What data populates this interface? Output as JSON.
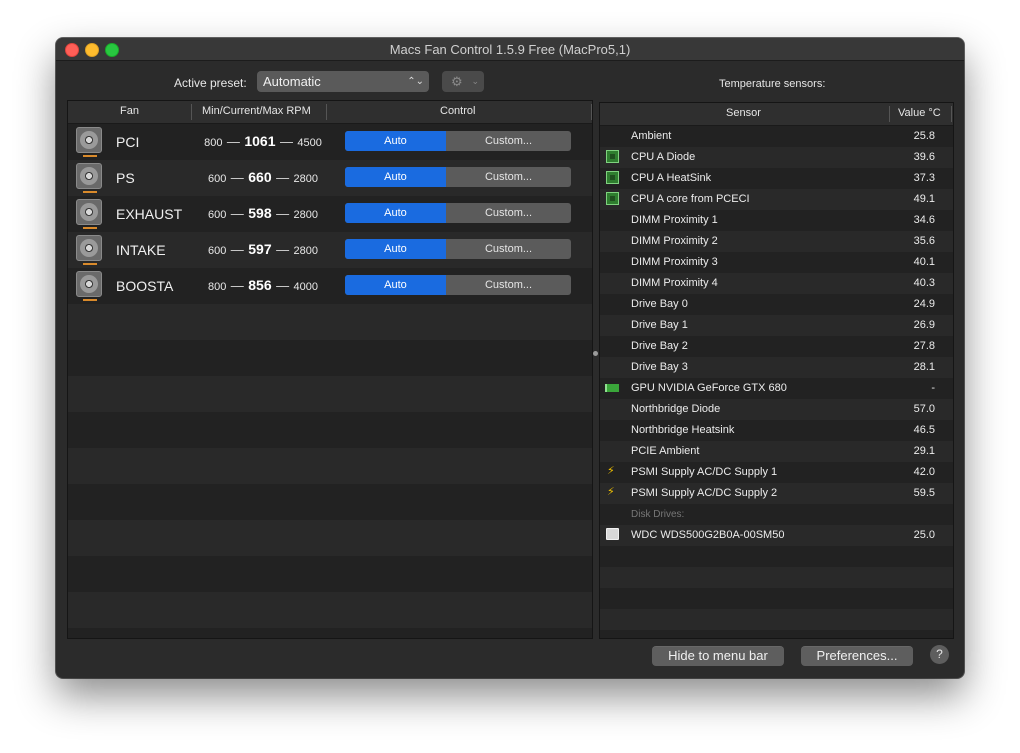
{
  "window": {
    "title": "Macs Fan Control 1.5.9 Free (MacPro5,1)"
  },
  "preset": {
    "label": "Active preset:",
    "value": "Automatic",
    "gear_icon": "gear-icon"
  },
  "sensors_title": "Temperature sensors:",
  "fan_table": {
    "columns": [
      "Fan",
      "Min/Current/Max RPM",
      "Control"
    ],
    "rows": [
      {
        "name": "PCI",
        "min": "800",
        "current": "1061",
        "max": "4500",
        "auto": "Auto",
        "custom": "Custom..."
      },
      {
        "name": "PS",
        "min": "600",
        "current": "660",
        "max": "2800",
        "auto": "Auto",
        "custom": "Custom..."
      },
      {
        "name": "EXHAUST",
        "min": "600",
        "current": "598",
        "max": "2800",
        "auto": "Auto",
        "custom": "Custom..."
      },
      {
        "name": "INTAKE",
        "min": "600",
        "current": "597",
        "max": "2800",
        "auto": "Auto",
        "custom": "Custom..."
      },
      {
        "name": "BOOSTA",
        "min": "800",
        "current": "856",
        "max": "4000",
        "auto": "Auto",
        "custom": "Custom..."
      }
    ],
    "dash": "—"
  },
  "sensor_table": {
    "columns": [
      "Sensor",
      "Value °C"
    ],
    "rows": [
      {
        "name": "Ambient",
        "value": "25.8",
        "icon": ""
      },
      {
        "name": "CPU A Diode",
        "value": "39.6",
        "icon": "chip"
      },
      {
        "name": "CPU A HeatSink",
        "value": "37.3",
        "icon": "chip"
      },
      {
        "name": "CPU A core from PCECI",
        "value": "49.1",
        "icon": "chip"
      },
      {
        "name": "DIMM Proximity 1",
        "value": "34.6",
        "icon": ""
      },
      {
        "name": "DIMM Proximity 2",
        "value": "35.6",
        "icon": ""
      },
      {
        "name": "DIMM Proximity 3",
        "value": "40.1",
        "icon": ""
      },
      {
        "name": "DIMM Proximity 4",
        "value": "40.3",
        "icon": ""
      },
      {
        "name": "Drive Bay 0",
        "value": "24.9",
        "icon": ""
      },
      {
        "name": "Drive Bay 1",
        "value": "26.9",
        "icon": ""
      },
      {
        "name": "Drive Bay 2",
        "value": "27.8",
        "icon": ""
      },
      {
        "name": "Drive Bay 3",
        "value": "28.1",
        "icon": ""
      },
      {
        "name": "GPU NVIDIA GeForce GTX 680",
        "value": "-",
        "icon": "gpu"
      },
      {
        "name": "Northbridge Diode",
        "value": "57.0",
        "icon": ""
      },
      {
        "name": "Northbridge Heatsink",
        "value": "46.5",
        "icon": ""
      },
      {
        "name": "PCIE Ambient",
        "value": "29.1",
        "icon": ""
      },
      {
        "name": "PSMI Supply AC/DC Supply 1",
        "value": "42.0",
        "icon": "bolt"
      },
      {
        "name": "PSMI Supply AC/DC Supply 2",
        "value": "59.5",
        "icon": "bolt"
      },
      {
        "name": "Disk Drives:",
        "value": "",
        "icon": "",
        "section": true
      },
      {
        "name": "WDC  WDS500G2B0A-00SM50",
        "value": "25.0",
        "icon": "disk"
      }
    ]
  },
  "buttons": {
    "hide": "Hide to menu bar",
    "preferences": "Preferences...",
    "help": "?"
  },
  "colors": {
    "accent": "#1a6be0",
    "window_bg": "#2b2b2b"
  }
}
